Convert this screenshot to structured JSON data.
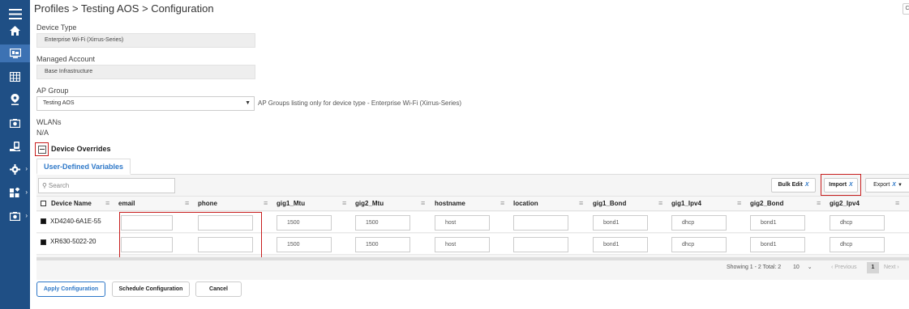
{
  "sidebar": {
    "items": [
      {
        "icon": "menu-icon"
      },
      {
        "icon": "home-icon"
      },
      {
        "icon": "monitor-icon"
      },
      {
        "icon": "table-icon"
      },
      {
        "icon": "location-pin-icon"
      },
      {
        "icon": "camera-icon"
      },
      {
        "icon": "device-hand-icon"
      },
      {
        "icon": "gear-icon"
      },
      {
        "icon": "widgets-icon"
      },
      {
        "icon": "camera-settings-icon"
      }
    ],
    "bg_color": "#1f4f85",
    "active_color": "#3d72b3"
  },
  "header": {
    "breadcrumb": "Profiles > Testing AOS > Configuration",
    "corner_button": "C"
  },
  "form": {
    "device_type_label": "Device Type",
    "device_type_value": "Enterprise Wi-Fi (Xirrus-Series)",
    "managed_account_label": "Managed Account",
    "managed_account_value": "Base Infrastructure",
    "ap_group_label": "AP Group",
    "ap_group_value": "Testing AOS",
    "ap_group_hint": "AP Groups listing only for device type - Enterprise Wi-Fi (Xirrus-Series)",
    "wlans_label": "WLANs",
    "wlans_value": "N/A",
    "device_overrides_label": "Device Overrides"
  },
  "tabs": [
    {
      "label": "User-Defined Variables",
      "active": true
    }
  ],
  "toolbar": {
    "search_placeholder": "Search",
    "bulk_edit": "Bulk Edit",
    "import": "Import",
    "export": "Export",
    "x_mark": "X"
  },
  "table": {
    "columns": [
      "Device Name",
      "email",
      "phone",
      "gig1_Mtu",
      "gig2_Mtu",
      "hostname",
      "location",
      "gig1_Bond",
      "gig1_Ipv4",
      "gig2_Bond",
      "gig2_Ipv4"
    ],
    "filter_glyph": "≡",
    "rows": [
      {
        "device": "XD4240-6A1E-55",
        "email": "",
        "phone": "",
        "gig1_Mtu": "1500",
        "gig2_Mtu": "1500",
        "hostname": "host",
        "location": "",
        "gig1_Bond": "bond1",
        "gig1_Ipv4": "dhcp",
        "gig2_Bond": "bond1",
        "gig2_Ipv4": "dhcp"
      },
      {
        "device": "XR630-5022-20",
        "email": "",
        "phone": "",
        "gig1_Mtu": "1500",
        "gig2_Mtu": "1500",
        "hostname": "host",
        "location": "",
        "gig1_Bond": "bond1",
        "gig1_Ipv4": "dhcp",
        "gig2_Bond": "bond1",
        "gig2_Ipv4": "dhcp"
      }
    ]
  },
  "pagination": {
    "showing": "Showing 1 - 2 Total: 2",
    "page_size": "10",
    "previous": "‹ Previous",
    "current_page": "1",
    "next": "Next ›"
  },
  "footer": {
    "apply": "Apply Configuration",
    "schedule": "Schedule Configuration",
    "cancel": "Cancel"
  },
  "colors": {
    "accent": "#2e78c8",
    "highlight": "#c81e1e"
  }
}
